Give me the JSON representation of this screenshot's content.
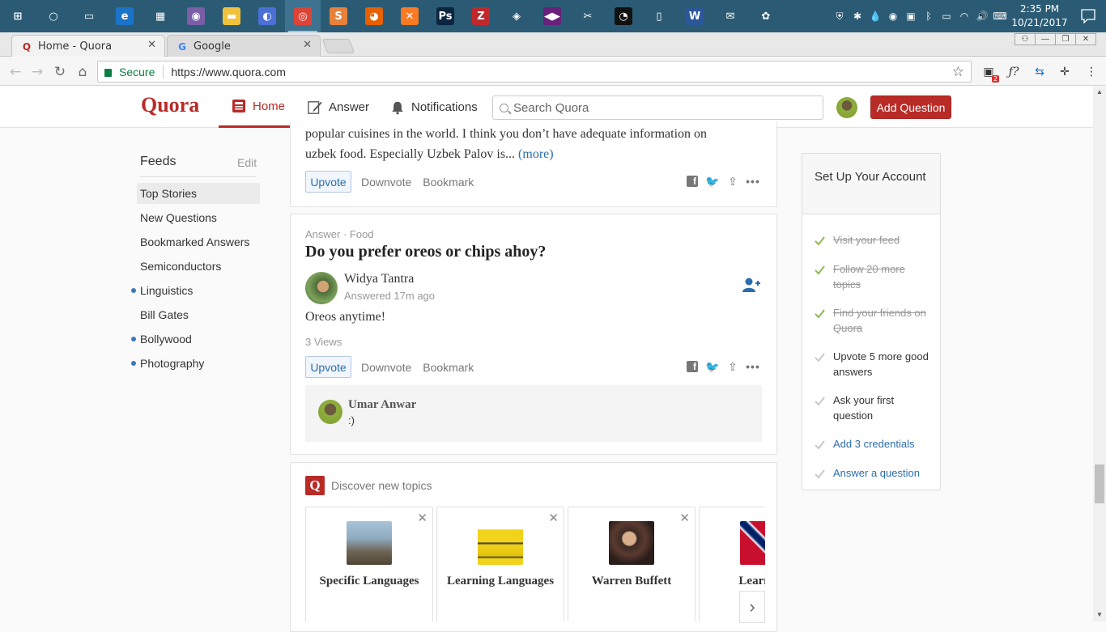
{
  "taskbar": {
    "icons": [
      {
        "name": "windows-start-icon",
        "glyph": "⊞",
        "bg": "transparent"
      },
      {
        "name": "cortana-icon",
        "glyph": "○",
        "bg": "transparent"
      },
      {
        "name": "task-view-icon",
        "glyph": "▭",
        "bg": "transparent"
      },
      {
        "name": "edge-icon",
        "glyph": "e",
        "bg": "#1a73c8"
      },
      {
        "name": "store-icon",
        "glyph": "▦",
        "bg": "transparent"
      },
      {
        "name": "tor-browser-icon",
        "glyph": "◉",
        "bg": "#7a5ea8"
      },
      {
        "name": "file-explorer-icon",
        "glyph": "▬",
        "bg": "#f0c23b"
      },
      {
        "name": "vpn-icon",
        "glyph": "◐",
        "bg": "#4a6fd6"
      },
      {
        "name": "chrome-icon",
        "glyph": "◎",
        "bg": "#db4437"
      },
      {
        "name": "sublime-icon",
        "glyph": "S",
        "bg": "#e8823a"
      },
      {
        "name": "firefox-icon",
        "glyph": "◕",
        "bg": "#e66000"
      },
      {
        "name": "xampp-icon",
        "glyph": "✕",
        "bg": "#fb7a24"
      },
      {
        "name": "photoshop-icon",
        "glyph": "Ps",
        "bg": "#0b2440"
      },
      {
        "name": "filezilla-icon",
        "glyph": "Z",
        "bg": "#c0282d"
      },
      {
        "name": "layers-icon",
        "glyph": "◈",
        "bg": "transparent"
      },
      {
        "name": "visual-studio-icon",
        "glyph": "◀▶",
        "bg": "#68217a"
      },
      {
        "name": "tools-icon",
        "glyph": "✂",
        "bg": "transparent"
      },
      {
        "name": "speedometer-icon",
        "glyph": "◔",
        "bg": "#111"
      },
      {
        "name": "document-icon",
        "glyph": "▯",
        "bg": "transparent"
      },
      {
        "name": "word-icon",
        "glyph": "W",
        "bg": "#2b579a"
      },
      {
        "name": "mail-icon",
        "glyph": "✉",
        "bg": "transparent"
      },
      {
        "name": "paint-icon",
        "glyph": "✿",
        "bg": "transparent"
      }
    ],
    "tray": [
      "shield-tray-icon",
      "network-tray-icon",
      "drop-tray-icon",
      "tor-tray-icon",
      "monitor-tray-icon",
      "bluetooth-tray-icon",
      "battery-tray-icon",
      "wifi-tray-icon",
      "volume-tray-icon",
      "keyboard-tray-icon"
    ],
    "tray_glyphs": [
      "⛨",
      "✱",
      "💧",
      "◉",
      "▣",
      "ᛒ",
      "▭",
      "◠",
      "🔊",
      "⌨"
    ],
    "time": "2:35 PM",
    "date": "10/21/2017"
  },
  "browser": {
    "tabs": [
      {
        "title": "Home - Quora",
        "fav": "Q",
        "fav_color": "#b92b27"
      },
      {
        "title": "Google",
        "fav": "G",
        "fav_color": "#4285f4"
      }
    ],
    "secure_label": "Secure",
    "url": "https://www.quora.com"
  },
  "quora": {
    "logo": "Quora",
    "nav": {
      "home": "Home",
      "answer": "Answer",
      "notifications": "Notifications"
    },
    "search_placeholder": "Search Quora",
    "add_question": "Add Question"
  },
  "sidebar": {
    "title": "Feeds",
    "edit": "Edit",
    "items": [
      {
        "label": "Top Stories",
        "selected": true,
        "dot": false
      },
      {
        "label": "New Questions",
        "selected": false,
        "dot": false
      },
      {
        "label": "Bookmarked Answers",
        "selected": false,
        "dot": false
      },
      {
        "label": "Semiconductors",
        "selected": false,
        "dot": false
      },
      {
        "label": "Linguistics",
        "selected": false,
        "dot": true
      },
      {
        "label": "Bill Gates",
        "selected": false,
        "dot": false
      },
      {
        "label": "Bollywood",
        "selected": false,
        "dot": true
      },
      {
        "label": "Photography",
        "selected": false,
        "dot": true
      }
    ]
  },
  "feed": {
    "prev": {
      "line1": "popular cuisines in the world. I think you don’t have adequate information on",
      "line2": "uzbek food. Especially Uzbek Palov is...",
      "more": "(more)"
    },
    "actions": {
      "upvote": "Upvote",
      "downvote": "Downvote",
      "bookmark": "Bookmark"
    },
    "answer": {
      "meta": "Answer · Food",
      "question": "Do you prefer oreos or chips ahoy?",
      "author": "Widya Tantra",
      "time": "Answered 17m ago",
      "text": "Oreos anytime!",
      "views": "3 Views",
      "comment_author": "Umar Anwar",
      "comment_text": ":)"
    },
    "discover": {
      "q": "Q",
      "title": "Discover new topics",
      "topics": [
        {
          "name": "Specific Languages",
          "img": "linear-gradient(180deg,#a9c4d9 0%,#8fa9bd 40%,#6e6454 70%,#4f4536 100%)"
        },
        {
          "name": "Learning Languages",
          "img": "linear-gradient(180deg,#fff 0%,#fff 18%,#f2d31b 20%,#f2d31b 48%,#2c2c2c 50%,#f2d31b 55%,#e2c10f 80%,#333 82%,#f2d31b 86%)"
        },
        {
          "name": "Warren Buffett",
          "img": "radial-gradient(circle at 45% 40%,#d9b08c 18%,#3b2a24 22%,#5a3a30 45%,#2a1d1a 70%)"
        },
        {
          "name": "Learning",
          "img": "linear-gradient(45deg,#c8102e 0%,#c8102e 40%,#fff 42%,#012169 46%,#012169 54%,#fff 58%,#c8102e 60%)"
        }
      ]
    }
  },
  "setup": {
    "title": "Set Up Your Account",
    "tasks": [
      {
        "label": "Visit your feed",
        "state": "done"
      },
      {
        "label": "Follow 20 more topics",
        "state": "done"
      },
      {
        "label": "Find your friends on Quora",
        "state": "done"
      },
      {
        "label": "Upvote 5 more good answers",
        "state": "pend"
      },
      {
        "label": "Ask your first question",
        "state": "pend"
      },
      {
        "label": "Add 3 credentials",
        "state": "link"
      },
      {
        "label": "Answer a question",
        "state": "link"
      }
    ]
  },
  "colors": {
    "brand": "#b92b27",
    "link": "#2b6dad",
    "check": "#8fb855",
    "taskbar": "#2b5b74"
  }
}
